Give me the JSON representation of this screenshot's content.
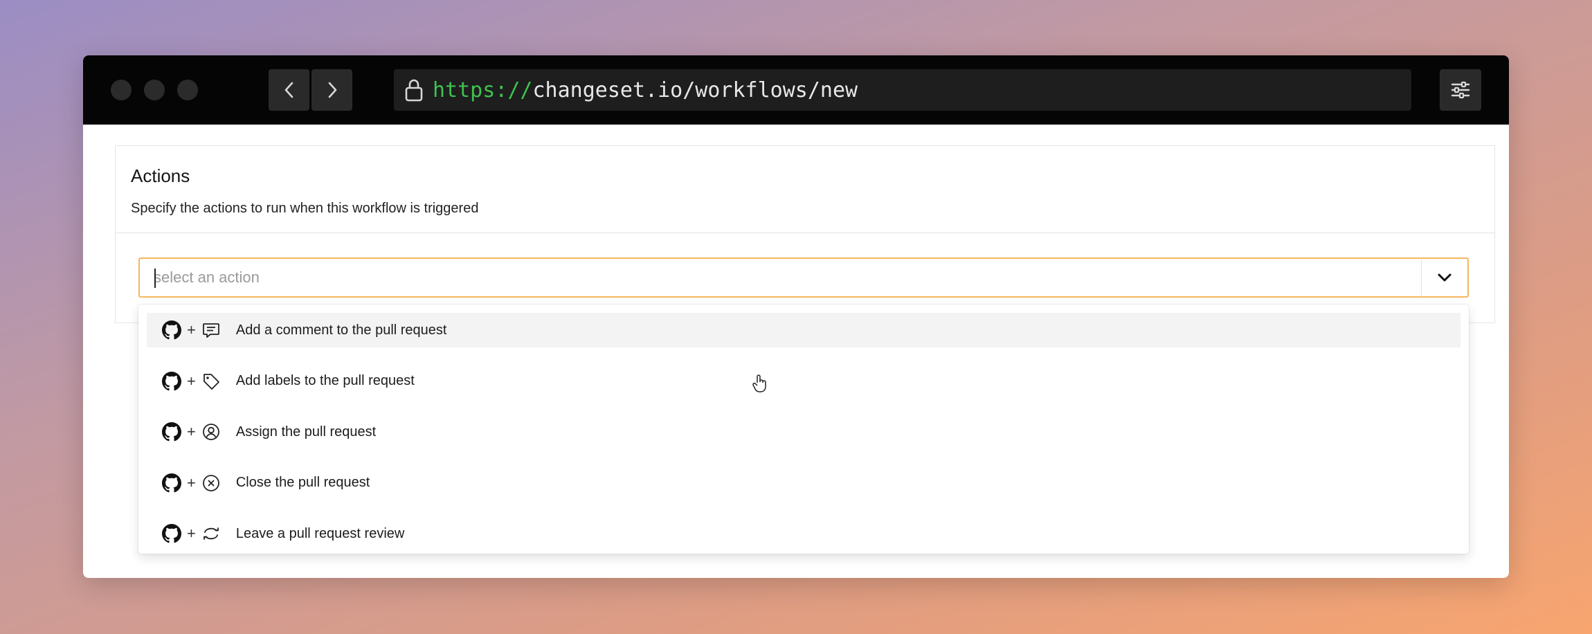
{
  "browser": {
    "url_scheme": "https://",
    "url_rest": "changeset.io/workflows/new",
    "nav_back_icon": "chevron-left-icon",
    "nav_forward_icon": "chevron-right-icon",
    "lock_icon": "lock-icon",
    "settings_icon": "sliders-icon"
  },
  "card": {
    "title": "Actions",
    "description": "Specify the actions to run when this workflow is triggered"
  },
  "select": {
    "placeholder": "select an action",
    "value": "",
    "accent_color": "#f6b65e"
  },
  "menu": {
    "items": [
      {
        "label": "Add a comment to the pull request",
        "provider_icon": "github-icon",
        "action_icon": "comment-icon",
        "active": true
      },
      {
        "label": "Add labels to the pull request",
        "provider_icon": "github-icon",
        "action_icon": "tag-icon",
        "active": false
      },
      {
        "label": "Assign the pull request",
        "provider_icon": "github-icon",
        "action_icon": "user-circle-icon",
        "active": false
      },
      {
        "label": "Close the pull request",
        "provider_icon": "github-icon",
        "action_icon": "close-circle-icon",
        "active": false
      },
      {
        "label": "Leave a pull request review",
        "provider_icon": "github-icon",
        "action_icon": "refresh-icon",
        "active": false
      }
    ],
    "plus_sign": "+"
  }
}
